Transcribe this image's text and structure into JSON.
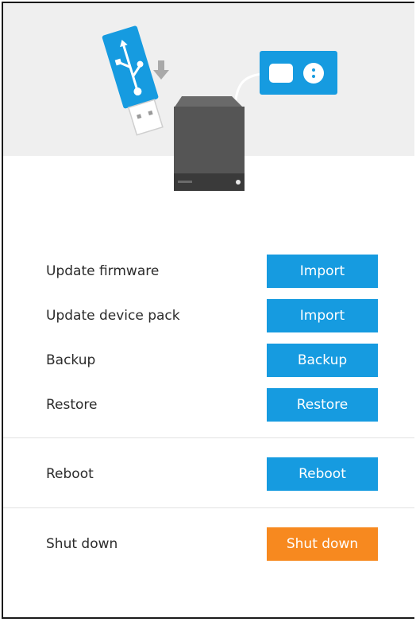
{
  "illustration": {
    "colors": {
      "accent": "#169BE0",
      "device": "#505050",
      "background": "#EFEFEF"
    }
  },
  "rows": [
    {
      "label": "Update firmware",
      "button": "Import"
    },
    {
      "label": "Update device pack",
      "button": "Import"
    },
    {
      "label": "Backup",
      "button": "Backup"
    },
    {
      "label": "Restore",
      "button": "Restore"
    },
    {
      "label": "Reboot",
      "button": "Reboot"
    },
    {
      "label": "Shut down",
      "button": "Shut down"
    }
  ],
  "colors": {
    "primary_button": "#169BE0",
    "danger_button": "#F7891F",
    "text": "#2B2B2B",
    "divider": "#E2E2E2"
  }
}
